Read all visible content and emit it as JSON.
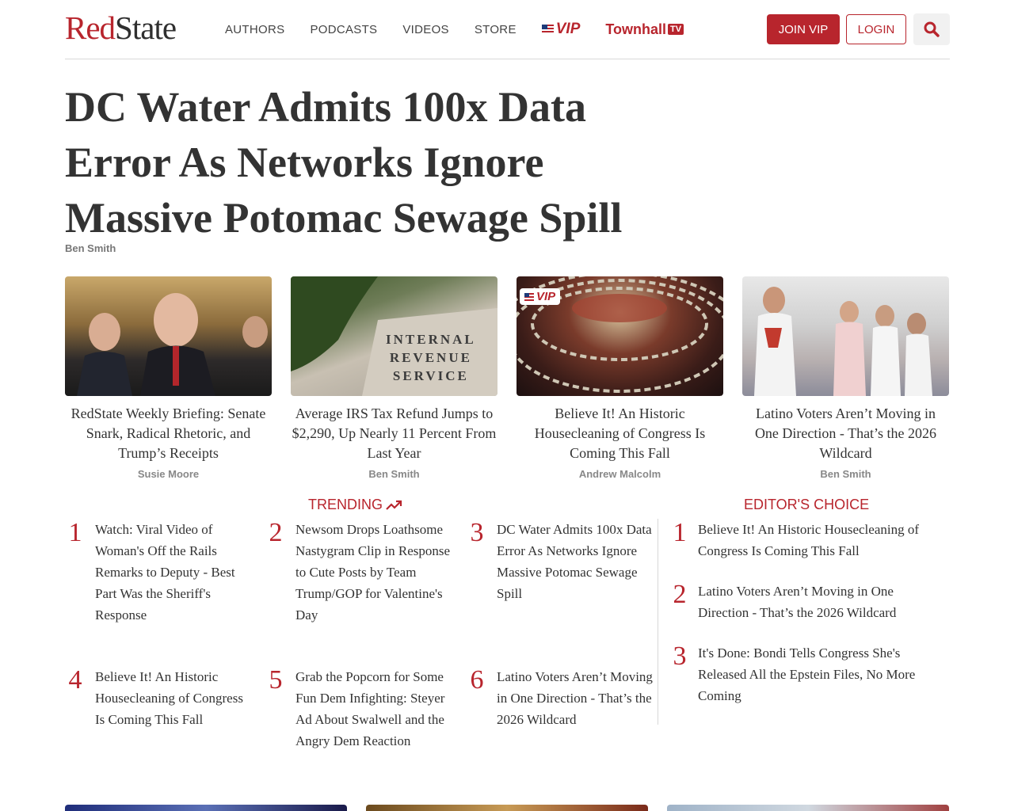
{
  "header": {
    "logo_red": "Red",
    "logo_dark": "State",
    "nav": [
      "AUTHORS",
      "PODCASTS",
      "VIDEOS",
      "STORE"
    ],
    "vip_label": "VIP",
    "townhall_label": "Townhall",
    "townhall_tv": "TV",
    "join_label": "JOIN VIP",
    "login_label": "LOGIN",
    "search_icon": "search-icon"
  },
  "headline": {
    "title": "DC Water Admits 100x Data Error As Networks Ignore Massive Potomac Sewage Spill",
    "author": "Ben Smith"
  },
  "cards": [
    {
      "title": "RedState Weekly Briefing: Senate Snark, Radical Rhetoric, and Trump’s Receipts",
      "author": "Susie Moore"
    },
    {
      "title": "Average IRS Tax Refund Jumps to $2,290, Up Nearly 11 Percent From Last Year",
      "author": "Ben Smith",
      "image_text": [
        "INTERNAL",
        "REVENUE",
        "SERVICE"
      ]
    },
    {
      "title": "Believe It! An Historic Housecleaning of Congress Is Coming This Fall",
      "author": "Andrew Malcolm",
      "badge": "VIP"
    },
    {
      "title": "Latino Voters Aren’t Moving in One Direction - That’s the 2026 Wildcard",
      "author": "Ben Smith"
    }
  ],
  "trending": {
    "label": "TRENDING",
    "items": [
      {
        "num": "1",
        "text": "Watch: Viral Video of Woman's Off the Rails Remarks to Deputy - Best Part Was the Sheriff's Response"
      },
      {
        "num": "2",
        "text": "Newsom Drops Loathsome Nastygram Clip in Response to Cute Posts by Team Trump/GOP for Valentine's Day"
      },
      {
        "num": "3",
        "text": "DC Water Admits 100x Data Error As Networks Ignore Massive Potomac Sewage Spill"
      },
      {
        "num": "4",
        "text": "Believe It! An Historic Housecleaning of Congress Is Coming This Fall"
      },
      {
        "num": "5",
        "text": "Grab the Popcorn for Some Fun Dem Infighting: Steyer Ad About Swalwell and the Angry Dem Reaction"
      },
      {
        "num": "6",
        "text": "Latino Voters Aren’t Moving in One Direction - That’s the 2026 Wildcard"
      }
    ]
  },
  "editors_choice": {
    "label": "EDITOR'S CHOICE",
    "items": [
      {
        "num": "1",
        "text": "Believe It! An Historic Housecleaning of Congress Is Coming This Fall"
      },
      {
        "num": "2",
        "text": "Latino Voters Aren’t Moving in One Direction - That’s the 2026 Wildcard"
      },
      {
        "num": "3",
        "text": "It's Done: Bondi Tells Congress She's Released All the Epstein Files, No More Coming"
      }
    ]
  },
  "colors": {
    "brand_red": "#b8252d",
    "text": "#333333"
  }
}
